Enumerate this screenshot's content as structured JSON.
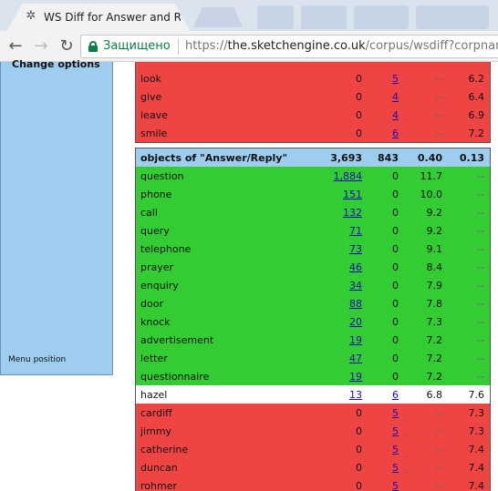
{
  "browser": {
    "tab_title": "WS Diff for Answer and R",
    "secure_label": "Защищено",
    "url_scheme": "https://",
    "url_host": "the.sketchengine.co.uk",
    "url_path": "/corpus/wsdiff?corpname"
  },
  "sidebar": {
    "change_options": "Change options",
    "menu_position": "Menu position"
  },
  "block1": {
    "rows": [
      {
        "word": "look",
        "c1": "0",
        "c2": "5",
        "c3": "--",
        "c4": "6.2"
      },
      {
        "word": "give",
        "c1": "0",
        "c2": "4",
        "c3": "--",
        "c4": "6.4"
      },
      {
        "word": "leave",
        "c1": "0",
        "c2": "4",
        "c3": "--",
        "c4": "6.9"
      },
      {
        "word": "smile",
        "c1": "0",
        "c2": "6",
        "c3": "--",
        "c4": "7.2"
      }
    ]
  },
  "block2": {
    "header": {
      "word": "objects of \"Answer/Reply\"",
      "c1": "3,693",
      "c2": "843",
      "c3": "0.40",
      "c4": "0.13"
    },
    "rows": [
      {
        "word": "question",
        "c1": "1,884",
        "c2": "0",
        "c3": "11.7",
        "c4": "--",
        "color": "green"
      },
      {
        "word": "phone",
        "c1": "151",
        "c2": "0",
        "c3": "10.0",
        "c4": "--",
        "color": "green"
      },
      {
        "word": "call",
        "c1": "132",
        "c2": "0",
        "c3": "9.2",
        "c4": "--",
        "color": "green"
      },
      {
        "word": "query",
        "c1": "71",
        "c2": "0",
        "c3": "9.2",
        "c4": "--",
        "color": "green"
      },
      {
        "word": "telephone",
        "c1": "73",
        "c2": "0",
        "c3": "9.1",
        "c4": "--",
        "color": "green"
      },
      {
        "word": "prayer",
        "c1": "46",
        "c2": "0",
        "c3": "8.4",
        "c4": "--",
        "color": "green"
      },
      {
        "word": "enquiry",
        "c1": "34",
        "c2": "0",
        "c3": "7.9",
        "c4": "--",
        "color": "green"
      },
      {
        "word": "door",
        "c1": "88",
        "c2": "0",
        "c3": "7.8",
        "c4": "--",
        "color": "green"
      },
      {
        "word": "knock",
        "c1": "20",
        "c2": "0",
        "c3": "7.3",
        "c4": "--",
        "color": "green"
      },
      {
        "word": "advertisement",
        "c1": "19",
        "c2": "0",
        "c3": "7.2",
        "c4": "--",
        "color": "green"
      },
      {
        "word": "letter",
        "c1": "47",
        "c2": "0",
        "c3": "7.2",
        "c4": "--",
        "color": "green"
      },
      {
        "word": "questionnaire",
        "c1": "19",
        "c2": "0",
        "c3": "7.2",
        "c4": "--",
        "color": "green"
      },
      {
        "word": "hazel",
        "c1": "13",
        "c2": "6",
        "c3": "6.8",
        "c4": "7.6",
        "color": "white"
      },
      {
        "word": "cardiff",
        "c1": "0",
        "c2": "5",
        "c3": "--",
        "c4": "7.3",
        "color": "red"
      },
      {
        "word": "jimmy",
        "c1": "0",
        "c2": "5",
        "c3": "--",
        "c4": "7.3",
        "color": "red"
      },
      {
        "word": "catherine",
        "c1": "0",
        "c2": "5",
        "c3": "--",
        "c4": "7.4",
        "color": "red"
      },
      {
        "word": "duncan",
        "c1": "0",
        "c2": "5",
        "c3": "--",
        "c4": "7.4",
        "color": "red"
      },
      {
        "word": "rohmer",
        "c1": "0",
        "c2": "5",
        "c3": "--",
        "c4": "7.4",
        "color": "red"
      }
    ]
  },
  "colors": {
    "green": "#33cc33",
    "red": "#ef4444",
    "header": "#9fcdf0",
    "link": "#1a0dab",
    "secure": "#0b8043"
  }
}
